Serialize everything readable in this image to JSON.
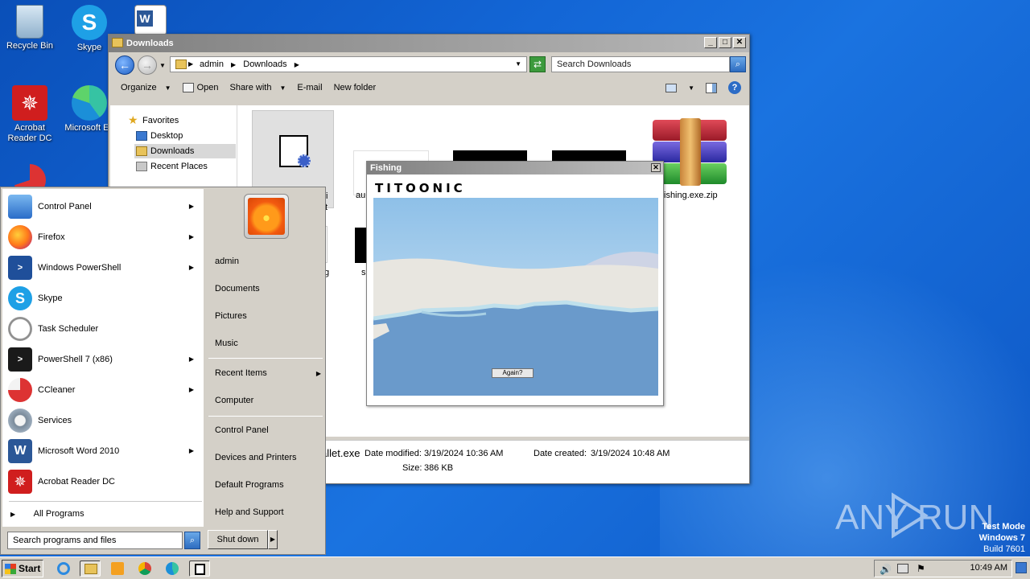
{
  "desktop": {
    "icons": [
      {
        "label": "Recycle Bin",
        "icon": "recycle-bin-icon"
      },
      {
        "label": "Skype",
        "icon": "skype-icon"
      },
      {
        "label": "Acrobat Reader DC",
        "icon": "acrobat-icon"
      },
      {
        "label": "Microsoft Ed",
        "icon": "edge-icon"
      }
    ],
    "watermark": {
      "line1": "Test Mode",
      "line2": "Windows 7",
      "line3": "Build 7601"
    },
    "brand": "ANY RUN"
  },
  "explorer": {
    "title": "Downloads",
    "address": {
      "part1": "admin",
      "part2": "Downloads"
    },
    "search_placeholder": "Search Downloads",
    "toolbar": {
      "organize": "Organize",
      "open": "Open",
      "share_with": "Share with",
      "email": "E-mail",
      "new_folder": "New folder"
    },
    "nav": {
      "favorites": "Favorites",
      "desktop": "Desktop",
      "downloads": "Downloads",
      "recent_places": "Recent Places"
    },
    "files": {
      "partial1": "fi",
      "partial2": "t",
      "partial3": "au",
      "zip_name": "ishing.exe.zip",
      "partial4": "g",
      "partial5": "s"
    },
    "details": {
      "name": "allet.exe",
      "date_modified_label": "Date modified:",
      "date_modified": "3/19/2024 10:36 AM",
      "date_created_label": "Date created:",
      "date_created": "3/19/2024 10:48 AM",
      "size_label": "Size:",
      "size": "386 KB"
    }
  },
  "fishing": {
    "title": "Fishing",
    "brand": "TITOONIC",
    "again": "Again?",
    "colors": {
      "sky": "#b8d6ee",
      "water": "#6a9acb",
      "ice": "#e8e6e0"
    }
  },
  "startmenu": {
    "left_items": [
      {
        "label": "Control Panel",
        "icon": "control-panel-icon",
        "submenu": true
      },
      {
        "label": "Firefox",
        "icon": "firefox-icon",
        "submenu": true
      },
      {
        "label": "Windows PowerShell",
        "icon": "powershell-icon",
        "submenu": true
      },
      {
        "label": "Skype",
        "icon": "skype-icon",
        "submenu": false
      },
      {
        "label": "Task Scheduler",
        "icon": "task-scheduler-icon",
        "submenu": false
      },
      {
        "label": "PowerShell 7 (x86)",
        "icon": "powershell7-icon",
        "submenu": true
      },
      {
        "label": "CCleaner",
        "icon": "ccleaner-icon",
        "submenu": true
      },
      {
        "label": "Services",
        "icon": "services-icon",
        "submenu": false
      },
      {
        "label": "Microsoft Word 2010",
        "icon": "word-icon",
        "submenu": true
      },
      {
        "label": "Acrobat Reader DC",
        "icon": "acrobat-icon",
        "submenu": false
      }
    ],
    "all_programs": "All Programs",
    "search_placeholder": "Search programs and files",
    "right_items": {
      "user": "admin",
      "documents": "Documents",
      "pictures": "Pictures",
      "music": "Music",
      "recent_items": "Recent Items",
      "computer": "Computer",
      "control_panel": "Control Panel",
      "devices_printers": "Devices and Printers",
      "default_programs": "Default Programs",
      "help_support": "Help and Support"
    },
    "shutdown": "Shut down"
  },
  "taskbar": {
    "start": "Start",
    "clock": "10:49 AM"
  }
}
